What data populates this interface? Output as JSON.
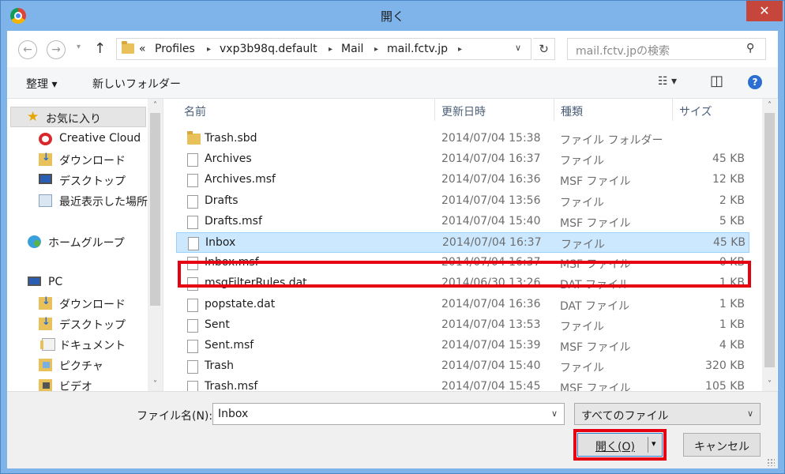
{
  "window": {
    "title": "開く",
    "close_glyph": "✕"
  },
  "nav_buttons": {
    "back_glyph": "←",
    "forward_glyph": "→",
    "dropdown_glyph": "▾",
    "up_glyph": "↑"
  },
  "address": {
    "overflow": "«",
    "crumbs": [
      "Profiles",
      "vxp3b98q.default",
      "Mail",
      "mail.fctv.jp"
    ],
    "separator": "▸",
    "dropdown_glyph": "∨",
    "refresh_glyph": "↻"
  },
  "search": {
    "placeholder": "mail.fctv.jpの検索",
    "icon_glyph": "⚲"
  },
  "toolbar": {
    "organize_label": "整理 ▾",
    "new_folder_label": "新しいフォルダー",
    "view_glyph": "☷ ▾",
    "pane_glyph": "◫",
    "help_glyph": "?"
  },
  "nav_pane": {
    "favorites": "お気に入り",
    "fav_items": [
      "Creative Cloud",
      "ダウンロード",
      "デスクトップ",
      "最近表示した場所"
    ],
    "homegroup": "ホームグループ",
    "pc": "PC",
    "pc_items": [
      "ダウンロード",
      "デスクトップ",
      "ドキュメント",
      "ピクチャ",
      "ビデオ"
    ],
    "scroll_up": "˄",
    "scroll_down": "˅"
  },
  "columns": {
    "name": "名前",
    "date": "更新日時",
    "type": "種類",
    "size": "サイズ",
    "sort_glyph": "˄"
  },
  "files": [
    {
      "name": "Trash.sbd",
      "date": "2014/07/04 15:38",
      "type": "ファイル フォルダー",
      "size": ""
    },
    {
      "name": "Archives",
      "date": "2014/07/04 16:37",
      "type": "ファイル",
      "size": "45 KB"
    },
    {
      "name": "Archives.msf",
      "date": "2014/07/04 16:36",
      "type": "MSF ファイル",
      "size": "12 KB"
    },
    {
      "name": "Drafts",
      "date": "2014/07/04 13:56",
      "type": "ファイル",
      "size": "2 KB"
    },
    {
      "name": "Drafts.msf",
      "date": "2014/07/04 15:40",
      "type": "MSF ファイル",
      "size": "5 KB"
    },
    {
      "name": "Inbox",
      "date": "2014/07/04 16:37",
      "type": "ファイル",
      "size": "45 KB"
    },
    {
      "name": "Inbox.msf",
      "date": "2014/07/04 16:37",
      "type": "MSF ファイル",
      "size": "0 KB"
    },
    {
      "name": "msgFilterRules.dat",
      "date": "2014/06/30 13:26",
      "type": "DAT ファイル",
      "size": "1 KB"
    },
    {
      "name": "popstate.dat",
      "date": "2014/07/04 16:36",
      "type": "DAT ファイル",
      "size": "1 KB"
    },
    {
      "name": "Sent",
      "date": "2014/07/04 13:53",
      "type": "ファイル",
      "size": "1 KB"
    },
    {
      "name": "Sent.msf",
      "date": "2014/07/04 15:39",
      "type": "MSF ファイル",
      "size": "4 KB"
    },
    {
      "name": "Trash",
      "date": "2014/07/04 15:40",
      "type": "ファイル",
      "size": "320 KB"
    },
    {
      "name": "Trash.msf",
      "date": "2014/07/04 15:45",
      "type": "MSF ファイル",
      "size": "105 KB"
    }
  ],
  "bottom": {
    "filename_label": "ファイル名(N):",
    "filename_value": "Inbox",
    "filter_value": "すべてのファイル",
    "dropdown_glyph": "∨",
    "open_label": "開く(O)",
    "open_dropdown_glyph": "▾",
    "cancel_label": "キャンセル"
  }
}
